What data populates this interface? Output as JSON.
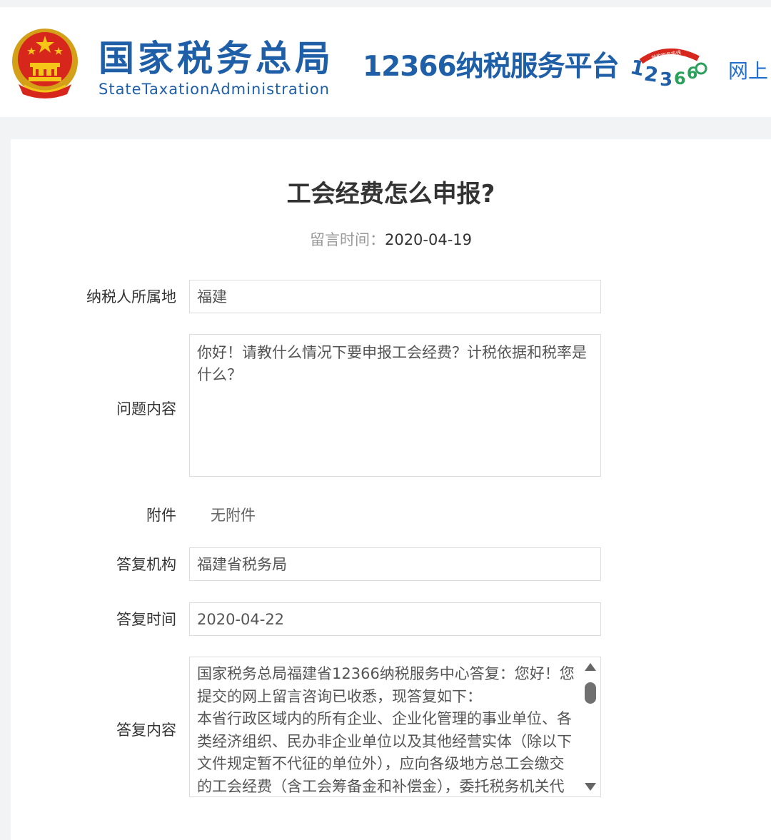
{
  "header": {
    "brand_cn": "国家税务总局",
    "brand_en": "StateTaxationAdministration",
    "platform": "12366纳税服务平台",
    "nav_partial": "网上",
    "brand_color": "#1f5fa8"
  },
  "page": {
    "title": "工会经费怎么申报?",
    "message_time_label": "留言时间：",
    "message_time": "2020-04-19"
  },
  "form": {
    "region": {
      "label": "纳税人所属地",
      "value": "福建"
    },
    "question": {
      "label": "问题内容",
      "value": "你好！请教什么情况下要申报工会经费？计税依据和税率是什么？"
    },
    "attachment": {
      "label": "附件",
      "value": "无附件"
    },
    "agency": {
      "label": "答复机构",
      "value": "福建省税务局"
    },
    "reply_time": {
      "label": "答复时间",
      "value": "2020-04-22"
    },
    "reply": {
      "label": "答复内容",
      "para1": "国家税务总局福建省12366纳税服务中心答复：您好！您提交的网上留言咨询已收悉，现答复如下：",
      "para2": "本省行政区域内的所有企业、企业化管理的事业单位、各类经济组织、民办非企业单位以及其他经营实体（除以下文件规定暂不代征的单位外），应向各级地方总工会缴交的工会经费（含工会筹备金和补偿金），委托税务机关代"
    }
  },
  "icons": [
    "national-emblem-icon",
    "12366-logo-icon",
    "scroll-up-icon",
    "scroll-down-icon"
  ]
}
